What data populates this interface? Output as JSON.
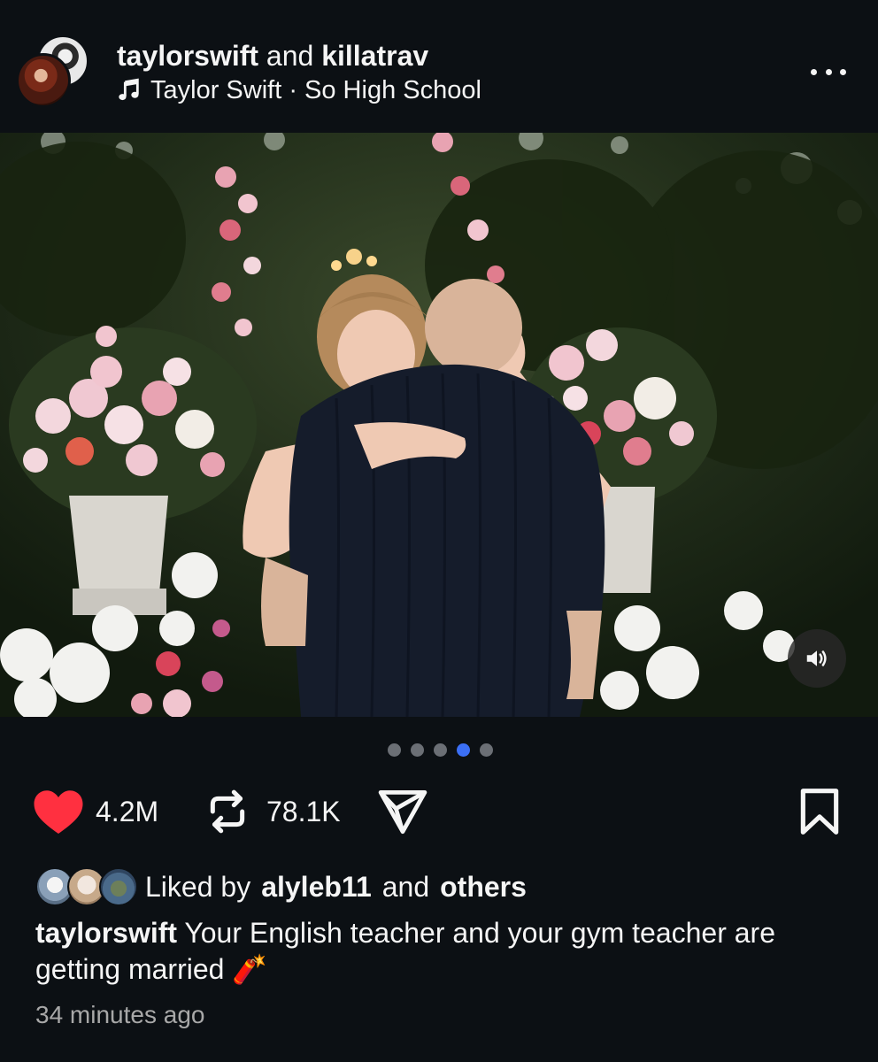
{
  "header": {
    "user1": "taylorswift",
    "conjunction": "and",
    "user2": "killatrav",
    "music_icon": "music-note-icon",
    "song": "Taylor Swift · So High School",
    "more_icon": "more-horizontal-icon"
  },
  "post": {
    "image_description_icon": "wedding-photo",
    "sound_icon": "speaker-icon",
    "carousel": {
      "total": 5,
      "active_index": 3
    }
  },
  "actions": {
    "like_icon": "heart-filled-icon",
    "like_count": "4.2M",
    "repost_icon": "repost-icon",
    "repost_count": "78.1K",
    "share_icon": "send-icon",
    "save_icon": "bookmark-icon"
  },
  "likes": {
    "prefix": "Liked by",
    "user": "alyleb11",
    "middle": "and",
    "others": "others"
  },
  "caption": {
    "user": "taylorswift",
    "text": "Your English teacher and your gym teacher are getting married",
    "emoji": "🧨"
  },
  "timestamp": "34 minutes ago",
  "colors": {
    "background": "#0c1014",
    "heart": "#ff3040",
    "active_dot": "#3b6ff5",
    "text": "#f5f5f5",
    "muted": "#a8a8a8"
  }
}
